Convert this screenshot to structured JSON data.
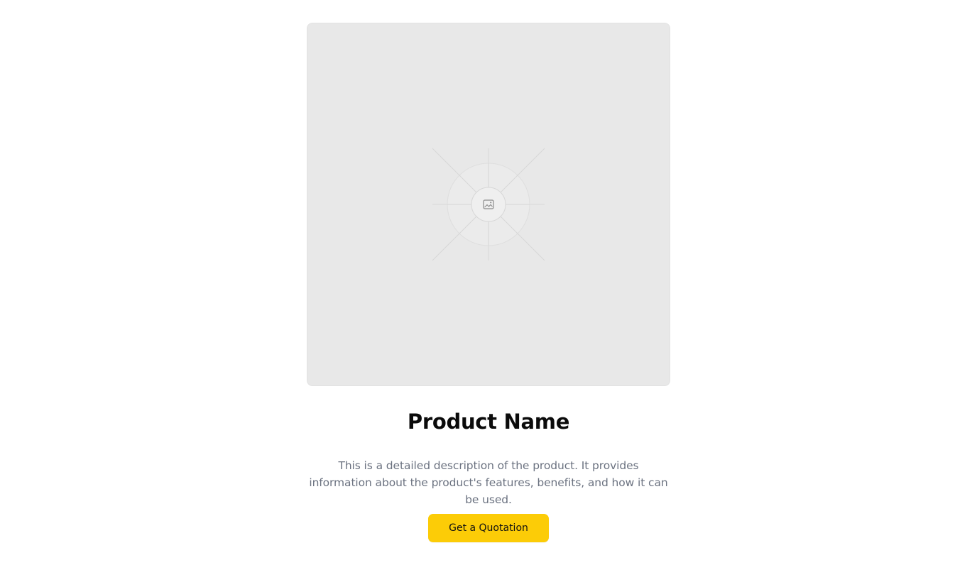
{
  "product": {
    "image_icon": "image-icon",
    "name": "Product Name",
    "description": "This is a detailed description of the product. It provides information about the product's features, benefits, and how it can be used.",
    "cta_label": "Get a Quotation"
  },
  "colors": {
    "background": "#ffffff",
    "image_placeholder": "#e8e8e8",
    "title": "#0b0b0b",
    "description": "#6b7280",
    "accent": "#fccc07"
  }
}
